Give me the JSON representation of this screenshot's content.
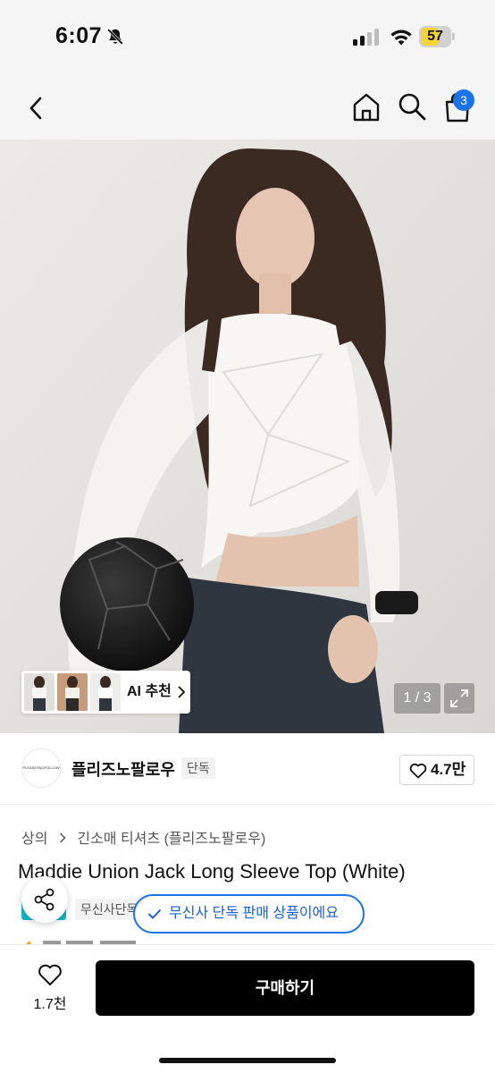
{
  "status_bar": {
    "time": "6:07",
    "battery": "57",
    "icons": [
      "bell-off-icon",
      "cellular-signal-icon",
      "wifi-icon",
      "battery-icon"
    ]
  },
  "nav": {
    "icons": [
      "back-arrow-icon",
      "home-icon",
      "search-icon",
      "shopping-bag-icon"
    ],
    "cart_count": "3"
  },
  "gallery": {
    "ai_label": "AI 추천",
    "counter": "1 / 3",
    "thumbnail_count": 3
  },
  "brand": {
    "logo_text": "PLEASESNOFOLLOW",
    "name": "플리즈노팔로우",
    "tag": "단독",
    "likes": "4.7만"
  },
  "category": {
    "items": [
      "상의",
      "긴소매 티셔츠 (플리즈노팔로우)"
    ]
  },
  "product": {
    "title": "Maddie Union Jack Long Sleeve Top (White)",
    "exclusive_label": "무신사단독"
  },
  "toast": {
    "message": "무신사 단독 판매 상품이에요"
  },
  "bottom_bar": {
    "wish_count": "1.7천",
    "buy_label": "구매하기"
  },
  "colors": {
    "accent_blue": "#1a73e8",
    "battery_yellow": "#f7d33a",
    "exclusive_teal": "#19b7c7",
    "buy_button": "#000000"
  }
}
